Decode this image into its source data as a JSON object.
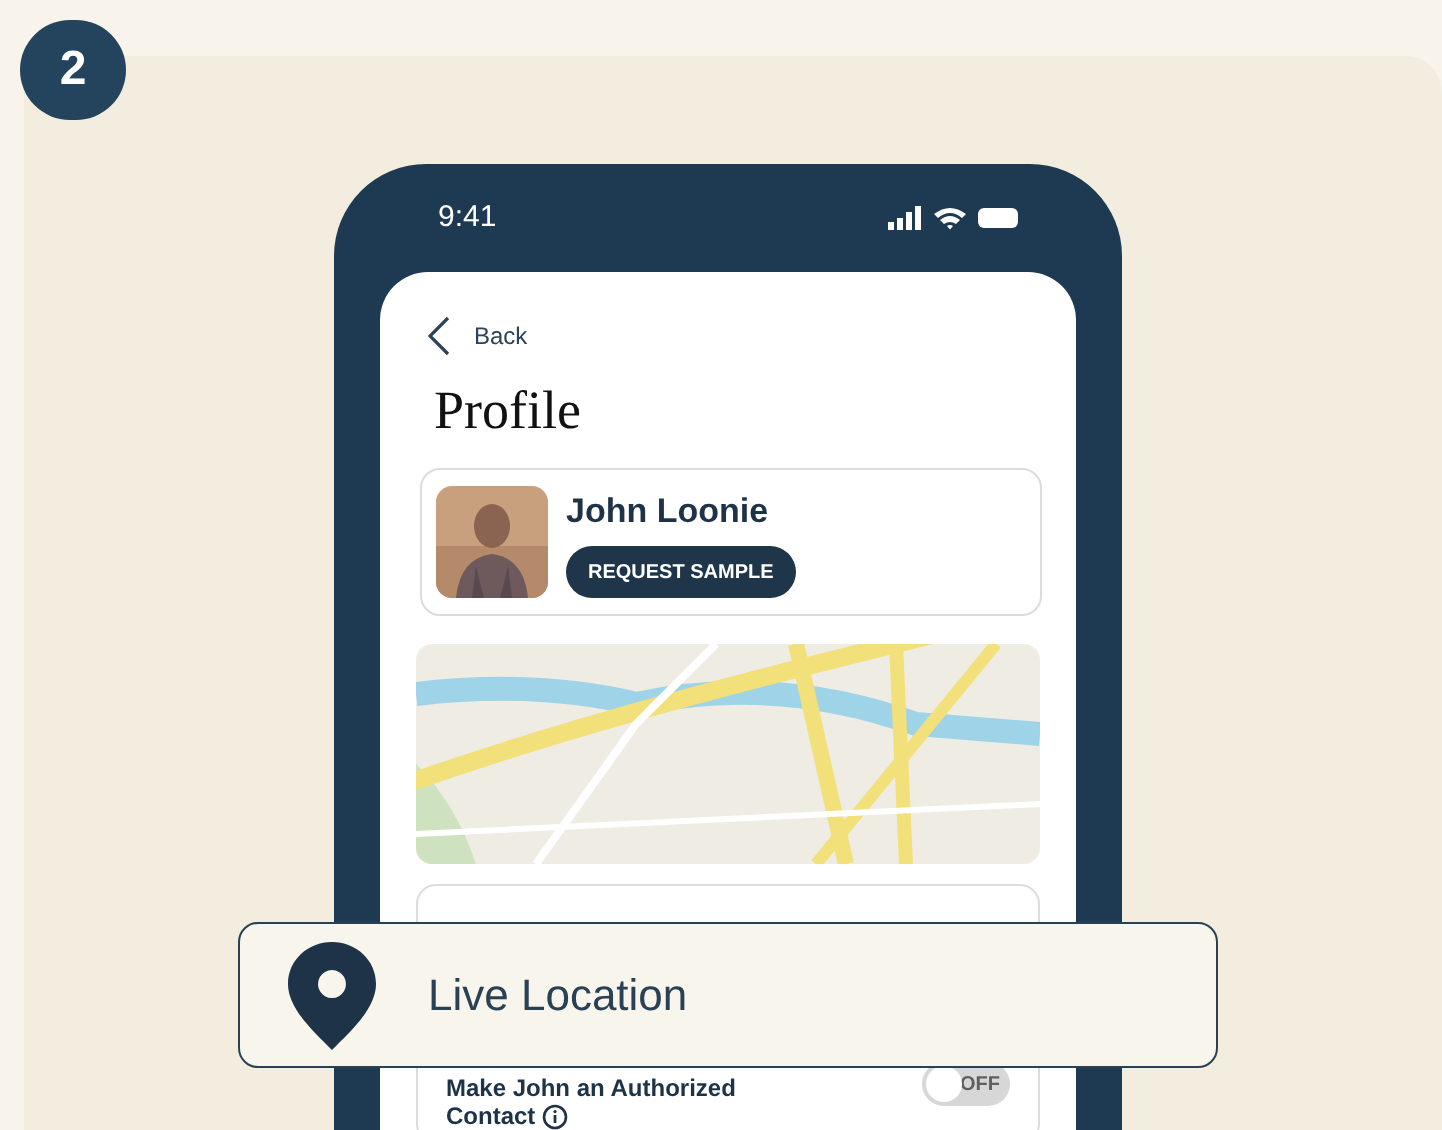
{
  "step_badge": "2",
  "phone": {
    "status_time": "9:41",
    "back_label": "Back",
    "title": "Profile",
    "profile": {
      "name": "John Loonie",
      "action": "REQUEST SAMPLE"
    },
    "authorized_contact": {
      "label": "Make John an Authorized Contact",
      "on": false,
      "state_label": "OFF"
    }
  },
  "callout": {
    "label": "Live Location"
  }
}
